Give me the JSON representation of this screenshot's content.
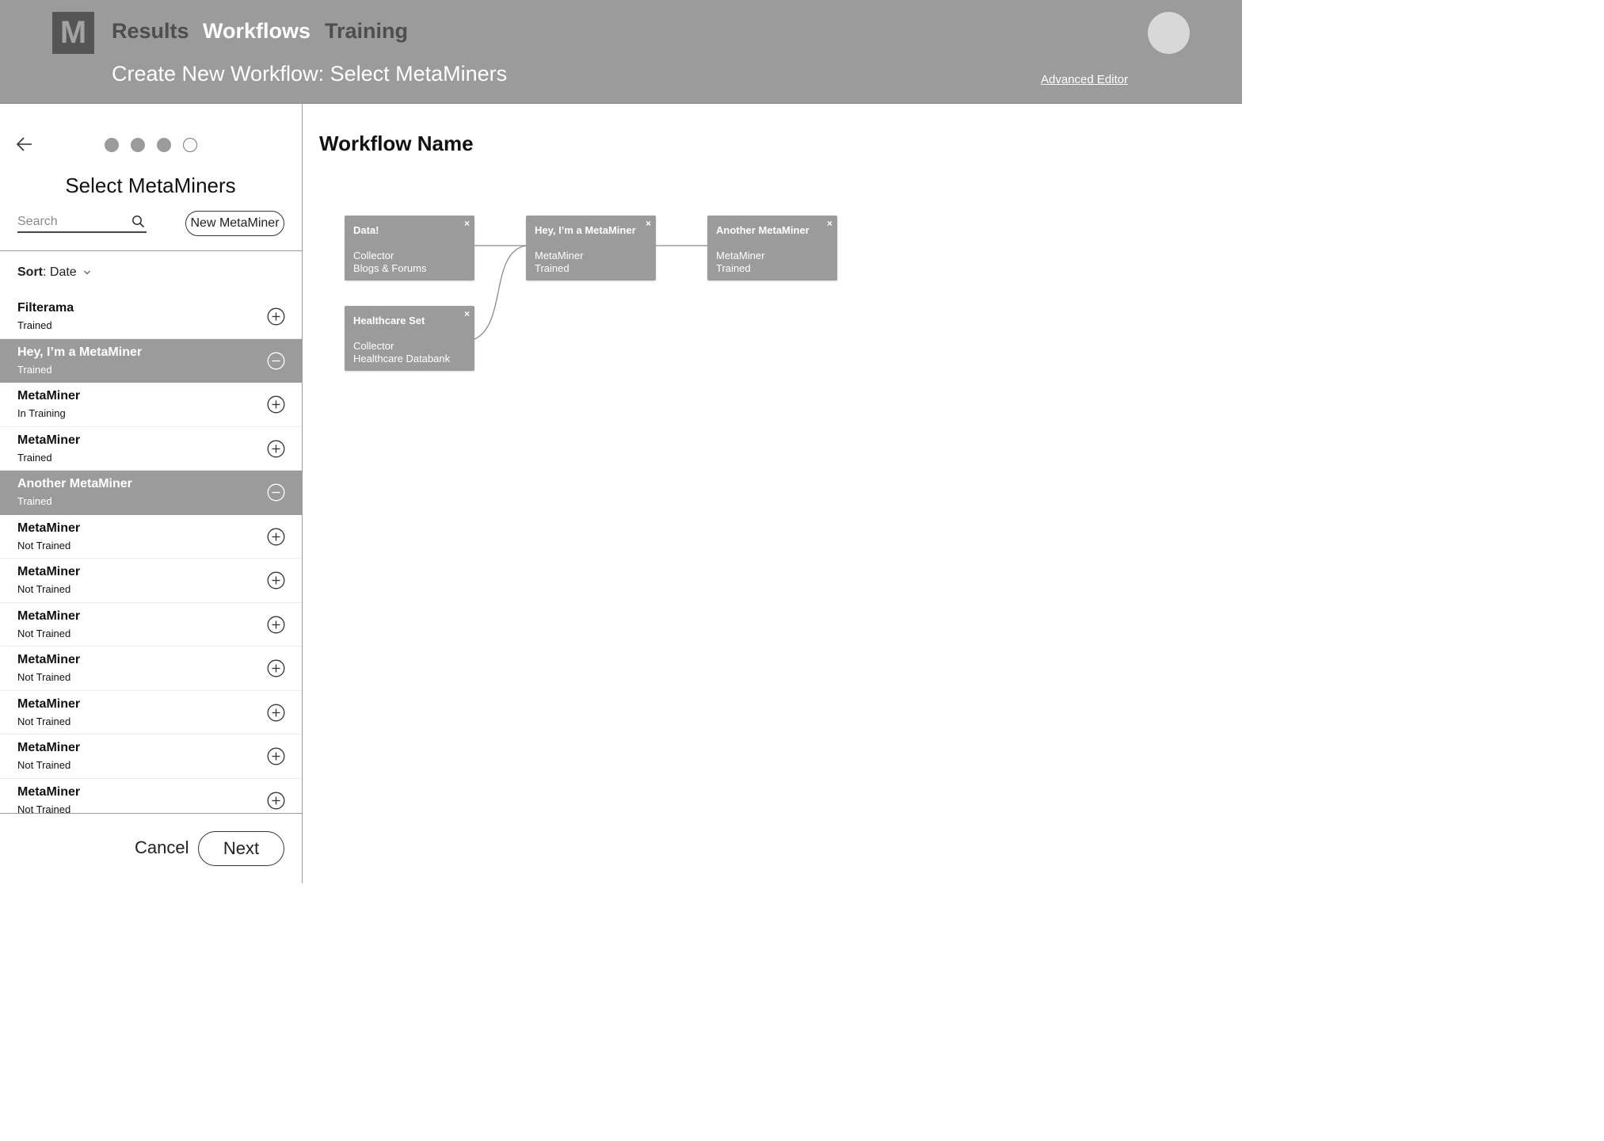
{
  "header": {
    "logo": "M",
    "nav": [
      "Results",
      "Workflows",
      "Training"
    ],
    "active_nav": "Workflows",
    "subtitle": "Create New Workflow: Select MetaMiners",
    "advanced_link": "Advanced Editor"
  },
  "sidebar": {
    "steps_total": 4,
    "steps_completed": 3,
    "title": "Select MetaMiners",
    "search": {
      "placeholder": "Search",
      "value": ""
    },
    "new_button": "New MetaMiner",
    "sort": {
      "label": "Sort",
      "value": "Date"
    },
    "items": [
      {
        "name": "Filterama",
        "status": "Trained",
        "selected": false
      },
      {
        "name": "Hey, I’m a MetaMiner",
        "status": "Trained",
        "selected": true
      },
      {
        "name": "MetaMiner",
        "status": "In Training",
        "selected": false
      },
      {
        "name": "MetaMiner",
        "status": "Trained",
        "selected": false
      },
      {
        "name": "Another MetaMiner",
        "status": "Trained",
        "selected": true
      },
      {
        "name": "MetaMiner",
        "status": "Not Trained",
        "selected": false
      },
      {
        "name": "MetaMiner",
        "status": "Not Trained",
        "selected": false
      },
      {
        "name": "MetaMiner",
        "status": "Not Trained",
        "selected": false
      },
      {
        "name": "MetaMiner",
        "status": "Not Trained",
        "selected": false
      },
      {
        "name": "MetaMiner",
        "status": "Not Trained",
        "selected": false
      },
      {
        "name": "MetaMiner",
        "status": "Not Trained",
        "selected": false
      },
      {
        "name": "MetaMiner",
        "status": "Not Trained",
        "selected": false
      }
    ],
    "cancel": "Cancel",
    "next": "Next"
  },
  "canvas": {
    "workflow_name": "Workflow Name",
    "nodes": [
      {
        "title": "Data!",
        "line1": "Collector",
        "line2": "Blogs & Forums",
        "close": "×"
      },
      {
        "title": "Hey, I’m a MetaMiner",
        "line1": "MetaMiner",
        "line2": "Trained",
        "close": "×"
      },
      {
        "title": "Another MetaMiner",
        "line1": "MetaMiner",
        "line2": "Trained",
        "close": "×"
      },
      {
        "title": "Healthcare Set",
        "line1": "Collector",
        "line2": "Healthcare Databank",
        "close": "×"
      }
    ]
  },
  "colors": {
    "header_bg": "#9b9b9b",
    "node_bg": "#9b9b9b",
    "logo_bg": "#555555",
    "selected_row": "#9b9b9b"
  }
}
